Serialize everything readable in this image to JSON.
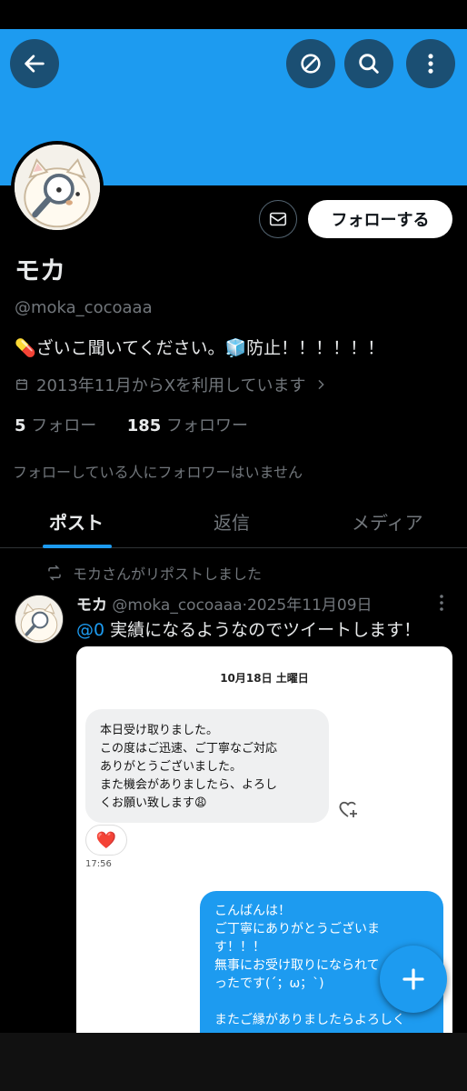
{
  "header": {
    "back_icon": "arrow-left-icon",
    "mute_icon": "no-entry-icon",
    "search_icon": "search-icon",
    "more_icon": "more-vertical-icon"
  },
  "profile": {
    "name": "モカ",
    "handle": "@moka_cocoaaa",
    "bio": "💊ざいこ聞いてください。🧊防止！！！！！！",
    "joined": "2013年11月からXを利用しています",
    "following_count": "5",
    "following_label": "フォロー",
    "followers_count": "185",
    "followers_label": "フォロワー",
    "followers_note": "フォローしている人にフォロワーはいません",
    "follow_button": "フォローする"
  },
  "tabs": [
    {
      "label": "ポスト"
    },
    {
      "label": "返信"
    },
    {
      "label": "メディア"
    }
  ],
  "tweet": {
    "repost_label": "モカさんがリポストしました",
    "author_name": "モカ",
    "author_handle": "@moka_cocoaaa",
    "separator": "·",
    "date": "2025年11月09日",
    "mention": "@0",
    "text": " 実績になるようなのでツイートします！"
  },
  "screenshot_chat": {
    "date": "10月18日 土曜日",
    "incoming": [
      "本日受け取りました。",
      "この度はご迅速、ご丁寧なご対応",
      "ありがとうございました。",
      "また機会がありましたら、よろし",
      "くお願い致します😩"
    ],
    "reaction": "❤️",
    "time": "17:56",
    "outgoing": [
      "こんばんは！",
      "ご丁寧にありがとうございま",
      "す！！！",
      "無事にお受け取りになられて",
      "ったです(´；ω；`)",
      "",
      "またご縁がありましたらよろしく"
    ]
  },
  "fab": {
    "icon": "plus-icon"
  },
  "colors": {
    "accent": "#1d9bf0",
    "background": "#000000",
    "muted": "#71767b"
  }
}
